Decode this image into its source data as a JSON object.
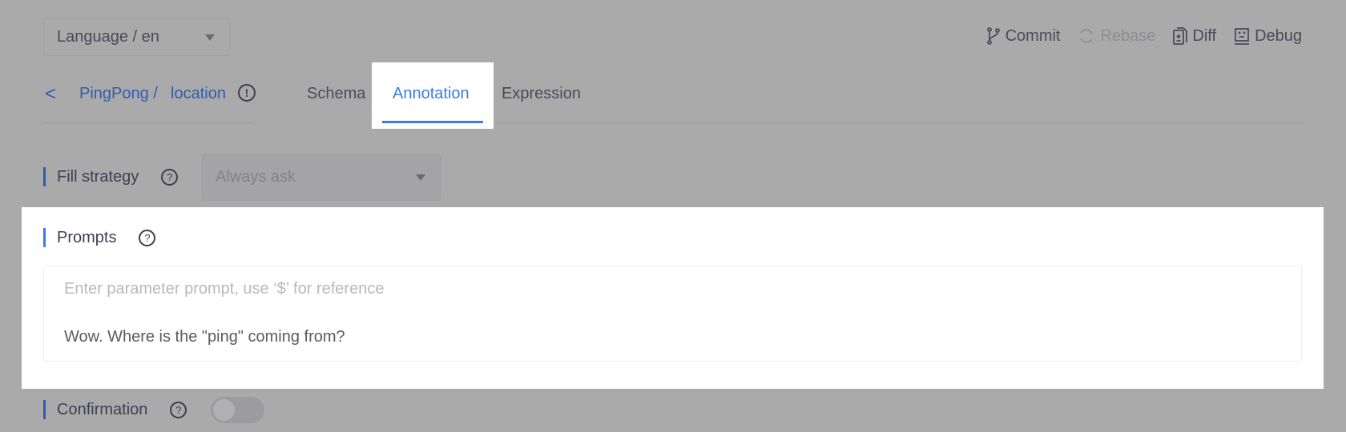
{
  "language_select": {
    "value": "Language / en"
  },
  "toolbar": {
    "commit": "Commit",
    "rebase": "Rebase",
    "diff": "Diff",
    "debug": "Debug"
  },
  "breadcrumb": {
    "parent": "PingPong /",
    "current": "location"
  },
  "tabs": [
    {
      "label": "Schema"
    },
    {
      "label": "Annotation",
      "active": true
    },
    {
      "label": "Expression"
    }
  ],
  "fill_strategy": {
    "label": "Fill strategy",
    "value": "Always ask"
  },
  "prompts": {
    "label": "Prompts",
    "placeholder": "Enter parameter prompt, use ‘$’ for reference",
    "value": "Wow. Where is the \"ping\" coming from?"
  },
  "confirmation": {
    "label": "Confirmation",
    "enabled": false
  },
  "colors": {
    "accent": "#3b7be8",
    "overlay": "#aaaaaa"
  }
}
